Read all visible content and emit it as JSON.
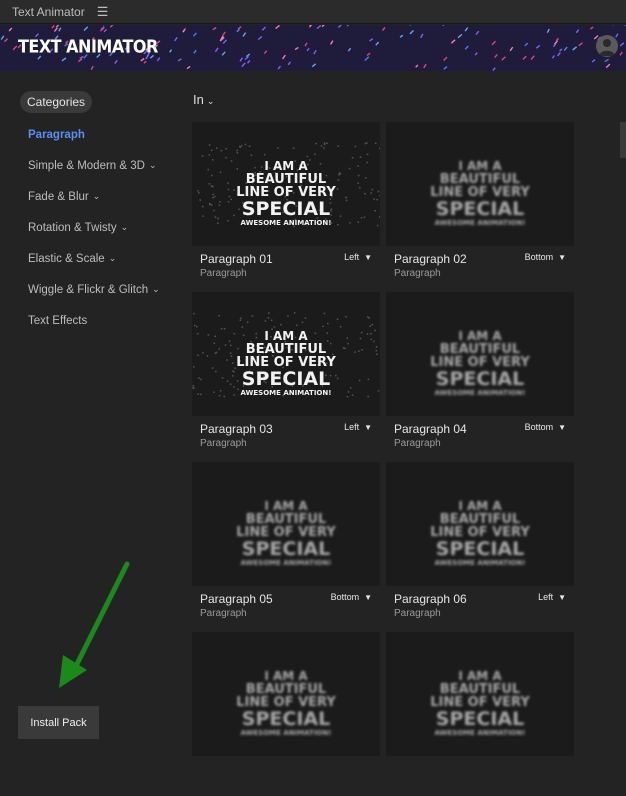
{
  "window": {
    "title": "Text Animator",
    "menu_icon": "hamburger-icon"
  },
  "banner": {
    "brand": "TEXT ANIMATOR",
    "avatar_icon": "user-avatar-icon"
  },
  "sidebar": {
    "categories_label": "Categories",
    "items": [
      {
        "label": "Paragraph",
        "active": true,
        "expandable": false
      },
      {
        "label": "Simple & Modern & 3D",
        "active": false,
        "expandable": true
      },
      {
        "label": "Fade & Blur",
        "active": false,
        "expandable": true
      },
      {
        "label": "Rotation & Twisty",
        "active": false,
        "expandable": true
      },
      {
        "label": "Elastic & Scale",
        "active": false,
        "expandable": true
      },
      {
        "label": "Wiggle & Flickr & Glitch",
        "active": false,
        "expandable": true
      },
      {
        "label": "Text Effects",
        "active": false,
        "expandable": false
      }
    ],
    "install_label": "Install Pack"
  },
  "filter": {
    "label": "In"
  },
  "preview_text": {
    "l1": "I AM A",
    "l2": "BEAUTIFUL",
    "l3": "LINE OF VERY",
    "l4": "SPECIAL",
    "l5": "AWESOME ANIMATION!"
  },
  "cards": [
    {
      "name": "Paragraph 01",
      "category": "Paragraph",
      "direction": "Left"
    },
    {
      "name": "Paragraph 02",
      "category": "Paragraph",
      "direction": "Bottom"
    },
    {
      "name": "Paragraph 03",
      "category": "Paragraph",
      "direction": "Left"
    },
    {
      "name": "Paragraph 04",
      "category": "Paragraph",
      "direction": "Bottom"
    },
    {
      "name": "Paragraph 05",
      "category": "Paragraph",
      "direction": "Bottom"
    },
    {
      "name": "Paragraph 06",
      "category": "Paragraph",
      "direction": "Left"
    }
  ],
  "colors": {
    "accent": "#5b8ef2",
    "arrow": "#1a8a1a",
    "background": "#232323"
  }
}
